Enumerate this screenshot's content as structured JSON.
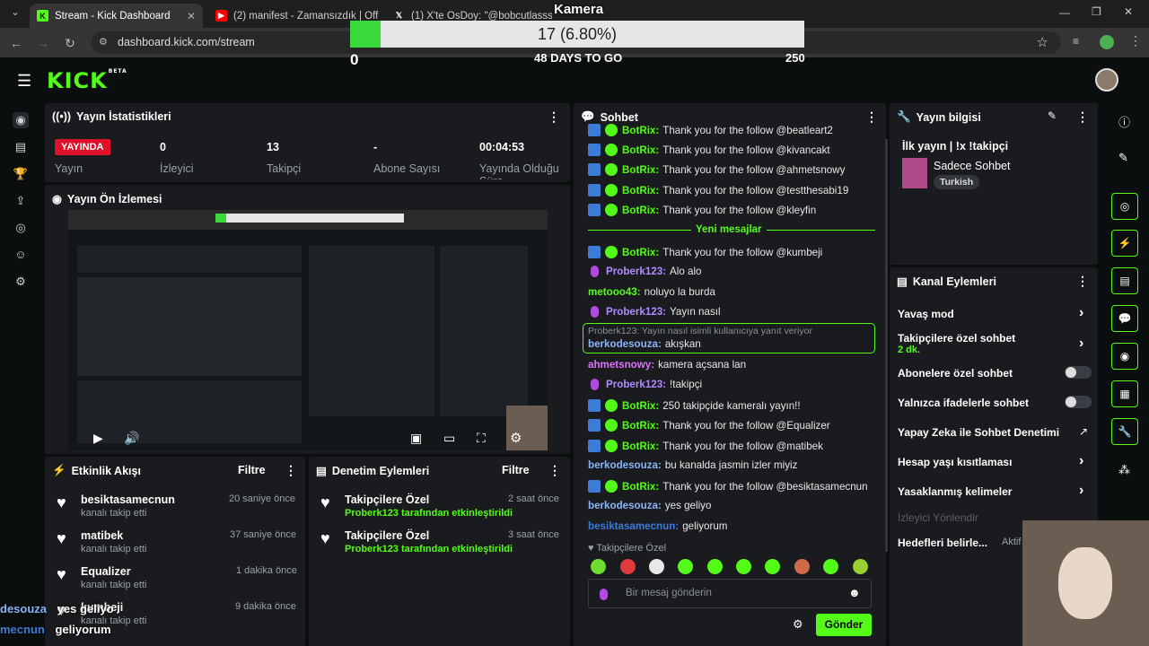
{
  "browser": {
    "tabs": [
      {
        "label": "Stream - Kick Dashboard",
        "active": true
      },
      {
        "label": "(2) manifest - Zamansızdık | Off",
        "active": false
      },
      {
        "label": "(1) X'te OsDoy: \"@bobcutlasss",
        "active": false
      }
    ],
    "url": "dashboard.kick.com/stream"
  },
  "overlay": {
    "title": "Kamera",
    "progress_text": "17 (6.80%)",
    "progress": 0.068,
    "min": "0",
    "max": "250",
    "days": "48 DAYS TO GO"
  },
  "logo": {
    "text": "KICK",
    "beta": "BETA"
  },
  "stats": {
    "title": "Yayın İstatistikleri",
    "badge": "YAYINDA",
    "live_label": "Yayın",
    "items": [
      {
        "value": "0",
        "label": "İzleyici"
      },
      {
        "value": "13",
        "label": "Takipçi"
      },
      {
        "value": "-",
        "label": "Abone Sayısı"
      },
      {
        "value": "00:04:53",
        "label": "Yayında Olduğu Süre"
      }
    ]
  },
  "preview": {
    "title": "Yayın Ön İzlemesi"
  },
  "activity": {
    "title": "Etkinlik Akışı",
    "filter": "Filtre",
    "items": [
      {
        "name": "besiktasamecnun",
        "sub": "kanalı takip etti",
        "time": "20 saniye önce"
      },
      {
        "name": "matibek",
        "sub": "kanalı takip etti",
        "time": "37 saniye önce"
      },
      {
        "name": "Equalizer",
        "sub": "kanalı takip etti",
        "time": "1 dakika önce"
      },
      {
        "name": "kumbeji",
        "sub": "kanalı takip etti",
        "time": "9 dakika önce"
      }
    ]
  },
  "moderation": {
    "title": "Denetim Eylemleri",
    "filter": "Filtre",
    "items": [
      {
        "name": "Takipçilere Özel",
        "user": "Proberk123",
        "suffix": "tarafından etkinleştirildi",
        "time": "2 saat önce"
      },
      {
        "name": "Takipçilere Özel",
        "user": "Proberk123",
        "suffix": "tarafından etkinleştirildi",
        "time": "3 saat önce"
      }
    ]
  },
  "chat": {
    "title": "Sohbet",
    "new_messages": "Yeni mesajlar",
    "messages": [
      {
        "user": "BotRix",
        "text": "Thank you for the follow @beatleart2",
        "type": "bot"
      },
      {
        "user": "BotRix",
        "text": "Thank you for the follow @kivancakt",
        "type": "bot"
      },
      {
        "user": "BotRix",
        "text": "Thank you for the follow @ahmetsnowy",
        "type": "bot"
      },
      {
        "user": "BotRix",
        "text": "Thank you for the follow @testthesabi19",
        "type": "bot"
      },
      {
        "user": "BotRix",
        "text": "Thank you for the follow @kleyfin",
        "type": "bot"
      },
      {
        "user": "BotRix",
        "text": "Thank you for the follow @kumbeji",
        "type": "bot"
      },
      {
        "user": "Proberk123",
        "text": "Alo alo",
        "type": "mod"
      },
      {
        "user": "metooo43",
        "text": "noluyo la burda",
        "type": "user",
        "color": "#53fc18"
      },
      {
        "user": "Proberk123",
        "text": "Yayın nasıl",
        "type": "mod"
      },
      {
        "user": "berkodesouza",
        "text": "akışkan",
        "type": "reply",
        "reply": "Proberk123: Yayın nasıl isimli kullanıcıya yanıt veriyor"
      },
      {
        "user": "ahmetsnowy",
        "text": "kamera açsana lan",
        "type": "user",
        "color": "#e070ff"
      },
      {
        "user": "Proberk123",
        "text": "!takipçi",
        "type": "mod"
      },
      {
        "user": "BotRix",
        "text": "250 takipçide kameralı yayın!!",
        "type": "bot"
      },
      {
        "user": "BotRix",
        "text": "Thank you for the follow @Equalizer",
        "type": "bot"
      },
      {
        "user": "BotRix",
        "text": "Thank you for the follow @matibek",
        "type": "bot"
      },
      {
        "user": "berkodesouza",
        "text": "bu kanalda jasmin izler miyiz",
        "type": "user",
        "color": "#8ab4f8"
      },
      {
        "user": "BotRix",
        "text": "Thank you for the follow @besiktasamecnun",
        "type": "bot"
      },
      {
        "user": "berkodesouza",
        "text": "yes geliyo",
        "type": "user",
        "color": "#8ab4f8"
      },
      {
        "user": "besiktasamecnun",
        "text": "geliyorum",
        "type": "user",
        "color": "#3c7bd6"
      }
    ],
    "mode": "Takipçilere Özel",
    "placeholder": "Bir mesaj gönderin",
    "send": "Gönder"
  },
  "info": {
    "title": "Yayın bilgisi",
    "stream_title": "İlk yayın | !x !takipçi",
    "category": "Sadece Sohbet",
    "language": "Turkish"
  },
  "actions": {
    "title": "Kanal Eylemleri",
    "slow": "Yavaş mod",
    "followers": "Takipçilere özel sohbet",
    "followers_sub": "2 dk.",
    "subs": "Abonelere özel sohbet",
    "emotes": "Yalnızca ifadelerle sohbet",
    "ai": "Yapay Zeka ile Sohbet Denetimi",
    "age": "Hesap yaşı kısıtlaması",
    "banned": "Yasaklanmış kelimeler",
    "redirect": "İzleyici Yönlendir",
    "goals": "Hedefleri belirle...",
    "goals_status": "Aktif"
  },
  "caption": {
    "line1a": "desouza",
    "line1b": "yes geliyo",
    "line2a": "mecnun",
    "line2b": "geliyorum"
  },
  "colors": {
    "accent": "#53fc18",
    "panel": "#191b1f"
  }
}
